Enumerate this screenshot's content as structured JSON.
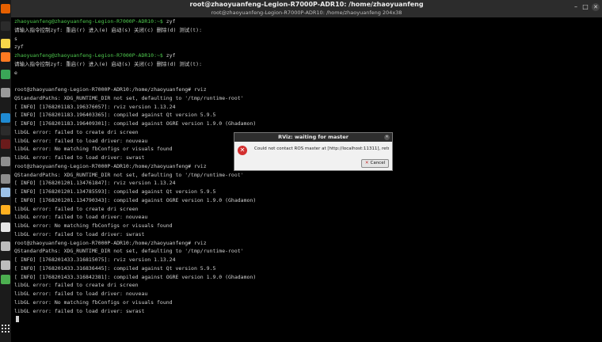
{
  "window": {
    "title": "root@zhaoyuanfeng-Legion-R7000P-ADR10: /home/zhaoyuanfeng",
    "subtitle": "root@zhaoyuanfeng-Legion-R7000P-ADR10: /home/zhaoyuanfeng 204x38"
  },
  "dock": {
    "items": [
      {
        "name": "firefox-icon",
        "color": "#e66000"
      },
      {
        "name": "terminal-icon",
        "color": "#2b2b2b"
      },
      {
        "name": "notes-icon",
        "color": "#f7d64a"
      },
      {
        "name": "software-icon",
        "color": "#ff7a21"
      },
      {
        "name": "chrome-icon",
        "color": "#3aa757"
      },
      {
        "name": "settings-icon",
        "color": "#9a9a9a"
      },
      {
        "name": "vscode-icon",
        "color": "#1f8ad2"
      },
      {
        "name": "terminal-icon",
        "color": "#2b2b2b"
      },
      {
        "name": "app-icon",
        "color": "#6a1b1b"
      },
      {
        "name": "settings-icon",
        "color": "#8e8e8e"
      },
      {
        "name": "settings-icon",
        "color": "#8e8e8e"
      },
      {
        "name": "app-icon",
        "color": "#9cc2e8"
      },
      {
        "name": "cat-icon",
        "color": "#ffb020"
      },
      {
        "name": "document-icon",
        "color": "#e6e6e6"
      },
      {
        "name": "disk-icon",
        "color": "#bdbdbd"
      },
      {
        "name": "disk-icon",
        "color": "#bdbdbd"
      },
      {
        "name": "recycle-icon",
        "color": "#4caf50"
      }
    ]
  },
  "terminal": {
    "lines": [
      {
        "prompt": "zhaoyuanfeng@zhaoyuanfeng-Legion-R7000P-ADR10:~$",
        "text": " zyf"
      },
      {
        "text": "请输入指令控制zyf: 重启(r) 进入(e) 启动(s) 关闭(c) 删除(d) 测试(t):"
      },
      {
        "text": "s"
      },
      {
        "text": "zyf"
      },
      {
        "prompt": "zhaoyuanfeng@zhaoyuanfeng-Legion-R7000P-ADR10:~$",
        "text": " zyf"
      },
      {
        "text": "请输入指令控制zyf: 重启(r) 进入(e) 启动(s) 关闭(c) 删除(d) 测试(t):"
      },
      {
        "text": "e"
      },
      {
        "text": ""
      },
      {
        "text": "root@zhaoyuanfeng-Legion-R7000P-ADR10:/home/zhaoyuanfeng# rviz"
      },
      {
        "text": "QStandardPaths: XDG_RUNTIME_DIR not set, defaulting to '/tmp/runtime-root'"
      },
      {
        "text": "[ INFO] [1768201183.196376057]: rviz version 1.13.24"
      },
      {
        "text": "[ INFO] [1768201183.196403365]: compiled against Qt version 5.9.5"
      },
      {
        "text": "[ INFO] [1768201183.196409301]: compiled against OGRE version 1.9.0 (Ghadamon)"
      },
      {
        "text": "libGL error: failed to create dri screen"
      },
      {
        "text": "libGL error: failed to load driver: nouveau"
      },
      {
        "text": "libGL error: No matching fbConfigs or visuals found"
      },
      {
        "text": "libGL error: failed to load driver: swrast"
      },
      {
        "text": "root@zhaoyuanfeng-Legion-R7000P-ADR10:/home/zhaoyuanfeng# rviz"
      },
      {
        "text": "QStandardPaths: XDG_RUNTIME_DIR not set, defaulting to '/tmp/runtime-root'"
      },
      {
        "text": "[ INFO] [1768201201.134761847]: rviz version 1.13.24"
      },
      {
        "text": "[ INFO] [1768201201.134785593]: compiled against Qt version 5.9.5"
      },
      {
        "text": "[ INFO] [1768201201.134790343]: compiled against OGRE version 1.9.0 (Ghadamon)"
      },
      {
        "text": "libGL error: failed to create dri screen"
      },
      {
        "text": "libGL error: failed to load driver: nouveau"
      },
      {
        "text": "libGL error: No matching fbConfigs or visuals found"
      },
      {
        "text": "libGL error: failed to load driver: swrast"
      },
      {
        "text": "root@zhaoyuanfeng-Legion-R7000P-ADR10:/home/zhaoyuanfeng# rviz"
      },
      {
        "text": "QStandardPaths: XDG_RUNTIME_DIR not set, defaulting to '/tmp/runtime-root'"
      },
      {
        "text": "[ INFO] [1768201433.316815075]: rviz version 1.13.24"
      },
      {
        "text": "[ INFO] [1768201433.316836445]: compiled against Qt version 5.9.5"
      },
      {
        "text": "[ INFO] [1768201433.316842381]: compiled against OGRE version 1.9.0 (Ghadamon)"
      },
      {
        "text": "libGL error: failed to create dri screen"
      },
      {
        "text": "libGL error: failed to load driver: nouveau"
      },
      {
        "text": "libGL error: No matching fbConfigs or visuals found"
      },
      {
        "text": "libGL error: failed to load driver: swrast"
      }
    ]
  },
  "dialog": {
    "title": "RViz: waiting for master",
    "message": "Could not contact ROS master at [http://localhost:11311], retrying...",
    "cancel_label": "Cancel",
    "icon": "error-icon"
  }
}
